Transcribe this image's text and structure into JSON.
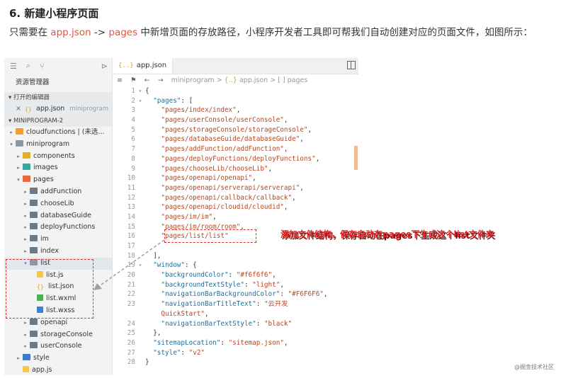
{
  "heading": "6. 新建小程序页面",
  "intro": {
    "p1": "只需要在 ",
    "hl1": "app.json",
    "p2": " -> ",
    "hl2": "pages",
    "p3": " 中新增页面的存放路径，小程序开发者工具即可帮我们自动创建对应的页面文件，如图所示："
  },
  "sidebar": {
    "title": "资源管理器",
    "open_editors_label": "打开的编辑器",
    "open_editor_file": "app.json",
    "open_editor_dir": "miniprogram",
    "project_label": "MINIPROGRAM-2",
    "tree": [
      {
        "label": "cloudfunctions | (未选...",
        "icon": "cloud",
        "indent": 1,
        "arrow": "▸"
      },
      {
        "label": "miniprogram",
        "icon": "folder-open",
        "indent": 1,
        "arrow": "▾"
      },
      {
        "label": "components",
        "icon": "comp",
        "indent": 2,
        "arrow": "▸"
      },
      {
        "label": "images",
        "icon": "img",
        "indent": 2,
        "arrow": "▸"
      },
      {
        "label": "pages",
        "icon": "pages",
        "indent": 2,
        "arrow": "▾"
      },
      {
        "label": "addFunction",
        "icon": "folder",
        "indent": 3,
        "arrow": "▸"
      },
      {
        "label": "chooseLib",
        "icon": "folder",
        "indent": 3,
        "arrow": "▸"
      },
      {
        "label": "databaseGuide",
        "icon": "folder",
        "indent": 3,
        "arrow": "▸"
      },
      {
        "label": "deployFunctions",
        "icon": "folder",
        "indent": 3,
        "arrow": "▸"
      },
      {
        "label": "im",
        "icon": "folder",
        "indent": 3,
        "arrow": "▸"
      },
      {
        "label": "index",
        "icon": "folder",
        "indent": 3,
        "arrow": "▸"
      },
      {
        "label": "list",
        "icon": "folder-open",
        "indent": 3,
        "arrow": "▾"
      },
      {
        "label": "list.js",
        "icon": "js",
        "indent": 4,
        "arrow": ""
      },
      {
        "label": "list.json",
        "icon": "json",
        "indent": 4,
        "arrow": ""
      },
      {
        "label": "list.wxml",
        "icon": "wxml",
        "indent": 4,
        "arrow": ""
      },
      {
        "label": "list.wxss",
        "icon": "wxss",
        "indent": 4,
        "arrow": ""
      },
      {
        "label": "openapi",
        "icon": "folder",
        "indent": 3,
        "arrow": "▸"
      },
      {
        "label": "storageConsole",
        "icon": "folder",
        "indent": 3,
        "arrow": "▸"
      },
      {
        "label": "userConsole",
        "icon": "folder",
        "indent": 3,
        "arrow": "▸"
      },
      {
        "label": "style",
        "icon": "style",
        "indent": 2,
        "arrow": "▸"
      },
      {
        "label": "app.js",
        "icon": "js",
        "indent": 2,
        "arrow": ""
      }
    ]
  },
  "editor": {
    "tab_label": "app.json",
    "breadcrumb": [
      "miniprogram",
      "app.json",
      "pages"
    ],
    "lines": [
      [
        [
          "p",
          "{"
        ]
      ],
      [
        [
          "p",
          "  "
        ],
        [
          "k",
          "\"pages\""
        ],
        [
          "p",
          ": ["
        ]
      ],
      [
        [
          "s",
          "    \"pages/index/index\""
        ],
        [
          "p",
          ","
        ]
      ],
      [
        [
          "s",
          "    \"pages/userConsole/userConsole\""
        ],
        [
          "p",
          ","
        ]
      ],
      [
        [
          "s",
          "    \"pages/storageConsole/storageConsole\""
        ],
        [
          "p",
          ","
        ]
      ],
      [
        [
          "s",
          "    \"pages/databaseGuide/databaseGuide\""
        ],
        [
          "p",
          ","
        ]
      ],
      [
        [
          "s",
          "    \"pages/addFunction/addFunction\""
        ],
        [
          "p",
          ","
        ]
      ],
      [
        [
          "s",
          "    \"pages/deployFunctions/deployFunctions\""
        ],
        [
          "p",
          ","
        ]
      ],
      [
        [
          "s",
          "    \"pages/chooseLib/chooseLib\""
        ],
        [
          "p",
          ","
        ]
      ],
      [
        [
          "s",
          "    \"pages/openapi/openapi\""
        ],
        [
          "p",
          ","
        ]
      ],
      [
        [
          "s",
          "    \"pages/openapi/serverapi/serverapi\""
        ],
        [
          "p",
          ","
        ]
      ],
      [
        [
          "s",
          "    \"pages/openapi/callback/callback\""
        ],
        [
          "p",
          ","
        ]
      ],
      [
        [
          "s",
          "    \"pages/openapi/cloudid/cloudid\""
        ],
        [
          "p",
          ","
        ]
      ],
      [
        [
          "s",
          "    \"pages/im/im\""
        ],
        [
          "p",
          ","
        ]
      ],
      [
        [
          "s",
          "    \"pages/im/room/room\""
        ],
        [
          "p",
          ","
        ]
      ],
      [
        [
          "s",
          "    \"pages/list/list\""
        ]
      ],
      [
        [
          "p",
          ""
        ]
      ],
      [
        [
          "p",
          "  ],"
        ]
      ],
      [
        [
          "p",
          "  "
        ],
        [
          "k",
          "\"window\""
        ],
        [
          "p",
          ": {"
        ]
      ],
      [
        [
          "p",
          "    "
        ],
        [
          "k",
          "\"backgroundColor\""
        ],
        [
          "p",
          ": "
        ],
        [
          "s",
          "\"#f6f6f6\""
        ],
        [
          "p",
          ","
        ]
      ],
      [
        [
          "p",
          "    "
        ],
        [
          "k",
          "\"backgroundTextStyle\""
        ],
        [
          "p",
          ": "
        ],
        [
          "s",
          "\"light\""
        ],
        [
          "p",
          ","
        ]
      ],
      [
        [
          "p",
          "    "
        ],
        [
          "k",
          "\"navigationBarBackgroundColor\""
        ],
        [
          "p",
          ": "
        ],
        [
          "s",
          "\"#F6F6F6\""
        ],
        [
          "p",
          ","
        ]
      ],
      [
        [
          "p",
          "    "
        ],
        [
          "k",
          "\"navigationBarTitleText\""
        ],
        [
          "p",
          ": "
        ],
        [
          "s",
          "\"云开发"
        ]
      ],
      [
        [
          "s",
          "    QuickStart\""
        ],
        [
          "p",
          ","
        ]
      ],
      [
        [
          "p",
          "    "
        ],
        [
          "k",
          "\"navigationBarTextStyle\""
        ],
        [
          "p",
          ": "
        ],
        [
          "s",
          "\"black\""
        ]
      ],
      [
        [
          "p",
          "  },"
        ]
      ],
      [
        [
          "p",
          "  "
        ],
        [
          "k",
          "\"sitemapLocation\""
        ],
        [
          "p",
          ": "
        ],
        [
          "s",
          "\"sitemap.json\""
        ],
        [
          "p",
          ","
        ]
      ],
      [
        [
          "p",
          "  "
        ],
        [
          "k",
          "\"style\""
        ],
        [
          "p",
          ": "
        ],
        [
          "s",
          "\"v2\""
        ]
      ],
      [
        [
          "p",
          "}"
        ]
      ]
    ],
    "line_numbers": [
      "1",
      "2",
      "3",
      "4",
      "5",
      "6",
      "7",
      "8",
      "9",
      "10",
      "11",
      "12",
      "13",
      "14",
      "15",
      "16",
      "17",
      "18",
      "19",
      "20",
      "21",
      "22",
      "23",
      "",
      "24",
      "25",
      "26",
      "27",
      "28"
    ],
    "folds": [
      "▾",
      "▾",
      "",
      "",
      "",
      "",
      "",
      "",
      "",
      "",
      "",
      "",
      "",
      "",
      "",
      "",
      "",
      "",
      "▾",
      "",
      "",
      "",
      "",
      "",
      "",
      "",
      "",
      "",
      ""
    ]
  },
  "annotation": "添加文件结构，保存自动在pages下生成这个list文件夹",
  "watermark": "@掘金技术社区",
  "colors": {
    "accent_red": "#e02020",
    "string": "#b5471f",
    "key": "#1f6f9f"
  }
}
